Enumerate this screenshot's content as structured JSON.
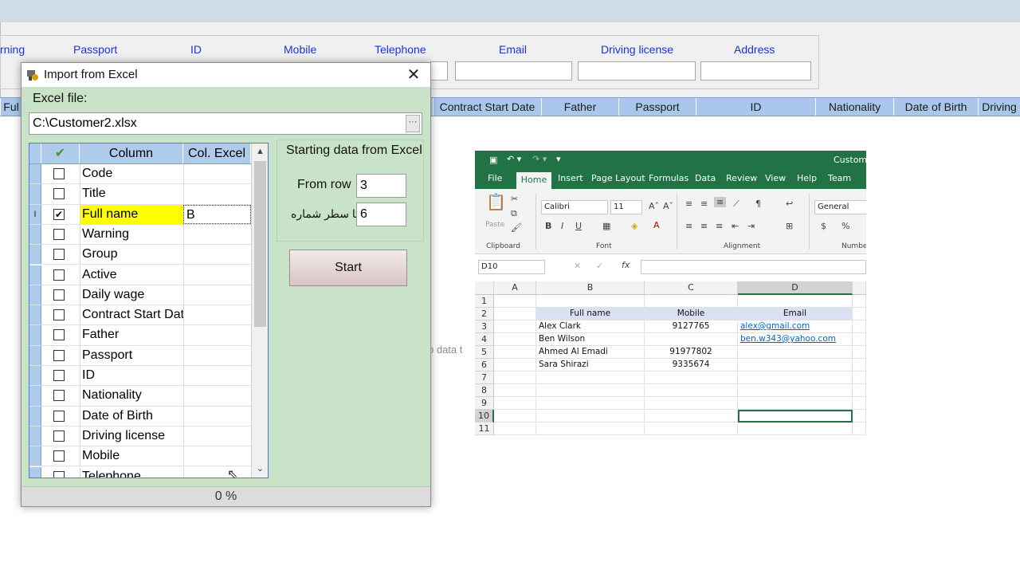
{
  "background_app": {
    "filter_labels": [
      "rning",
      "Passport",
      "ID",
      "Mobile",
      "Telephone",
      "Email",
      "Driving license",
      "Address"
    ],
    "grid_columns": [
      "Ful",
      "Contract Start Date",
      "Father",
      "Passport",
      "ID",
      "Nationality",
      "Date of Birth",
      "Driving"
    ],
    "empty_text": "o data t"
  },
  "dialog": {
    "title": "Import from Excel",
    "close_glyph": "✕",
    "excel_file_label": "Excel file:",
    "excel_file_path": "C:\\Customer2.xlsx",
    "browse_label": "···",
    "grid_headers": {
      "check": "✔",
      "column": "Column",
      "col_excel": "Col. Excel"
    },
    "rows": [
      {
        "name": "Code",
        "checked": false,
        "col": ""
      },
      {
        "name": "Title",
        "checked": false,
        "col": ""
      },
      {
        "name": "Full name",
        "checked": true,
        "col": "B",
        "selected": true
      },
      {
        "name": "Warning",
        "checked": false,
        "col": ""
      },
      {
        "name": "Group",
        "checked": false,
        "col": ""
      },
      {
        "name": "Active",
        "checked": false,
        "col": ""
      },
      {
        "name": "Daily wage",
        "checked": false,
        "col": ""
      },
      {
        "name": "Contract Start Date",
        "checked": false,
        "col": ""
      },
      {
        "name": "Father",
        "checked": false,
        "col": ""
      },
      {
        "name": "Passport",
        "checked": false,
        "col": ""
      },
      {
        "name": "ID",
        "checked": false,
        "col": ""
      },
      {
        "name": "Nationality",
        "checked": false,
        "col": ""
      },
      {
        "name": "Date of Birth",
        "checked": false,
        "col": ""
      },
      {
        "name": "Driving license",
        "checked": false,
        "col": ""
      },
      {
        "name": "Mobile",
        "checked": false,
        "col": ""
      },
      {
        "name": "Telephone",
        "checked": false,
        "col": ""
      }
    ],
    "selected_row_marker": "I",
    "starting_title": "Starting data from Excel",
    "from_row_label": "From row",
    "from_row_value": "3",
    "to_row_label": "تا سطر شماره",
    "to_row_value": "6",
    "start_button": "Start",
    "progress_text": "0 %",
    "scroll_up": "▲",
    "scroll_down": "⌄"
  },
  "excel": {
    "title": "Customer",
    "tabs": [
      "File",
      "Home",
      "Insert",
      "Page Layout",
      "Formulas",
      "Data",
      "Review",
      "View",
      "Help",
      "Team"
    ],
    "active_tab": "Home",
    "font_name": "Calibri",
    "font_size": "11",
    "number_format": "General",
    "groups": [
      "Clipboard",
      "Font",
      "Alignment",
      "Number"
    ],
    "paste_label": "Paste",
    "name_box": "D10",
    "fx": "fx",
    "columns": [
      "A",
      "B",
      "C",
      "D"
    ],
    "row_numbers": [
      "1",
      "2",
      "3",
      "4",
      "5",
      "6",
      "7",
      "8",
      "9",
      "10",
      "11"
    ],
    "header_row": [
      "Full name",
      "Mobile",
      "Email"
    ],
    "data_rows": [
      [
        "Alex Clark",
        "9127765",
        "alex@gmail.com"
      ],
      [
        "Ben Wilson",
        "",
        "ben.w343@yahoo.com"
      ],
      [
        "Ahmed Al Emadi",
        "91977802",
        ""
      ],
      [
        "Sara Shirazi",
        "9335674",
        ""
      ]
    ],
    "accent_color": "#217346"
  }
}
